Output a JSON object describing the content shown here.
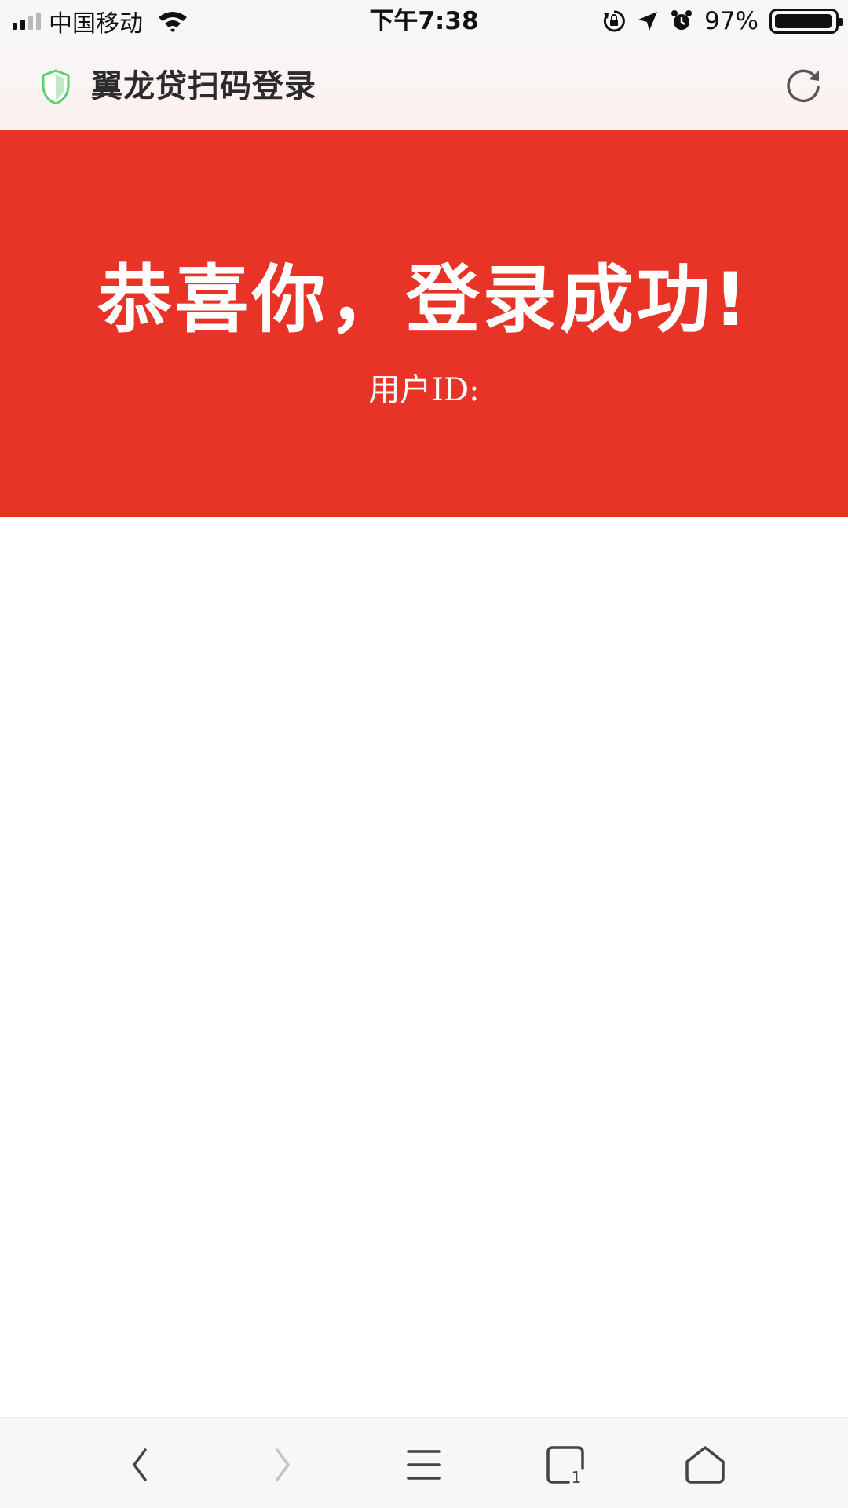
{
  "status_bar": {
    "carrier": "中国移动",
    "time": "下午7:38",
    "battery_percent": "97%",
    "battery_level": 0.97,
    "icons": [
      "signal-icon",
      "wifi-icon",
      "orientation-lock-icon",
      "location-arrow-icon",
      "alarm-icon",
      "battery-icon"
    ]
  },
  "browser": {
    "page_title": "翼龙贷扫码登录",
    "secure_icon": "shield-icon",
    "refresh_icon": "refresh-icon",
    "colors": {
      "shield": "#5ccf6a",
      "header_bg": "#f8f7f7"
    }
  },
  "banner": {
    "headline": "恭喜你，登录成功!",
    "user_id_label": "用户ID:",
    "color": "#e83327"
  },
  "toolbar": {
    "buttons": [
      "back-icon",
      "forward-icon",
      "menu-icon",
      "tabs-icon",
      "home-icon"
    ],
    "tabs_count": "1"
  }
}
